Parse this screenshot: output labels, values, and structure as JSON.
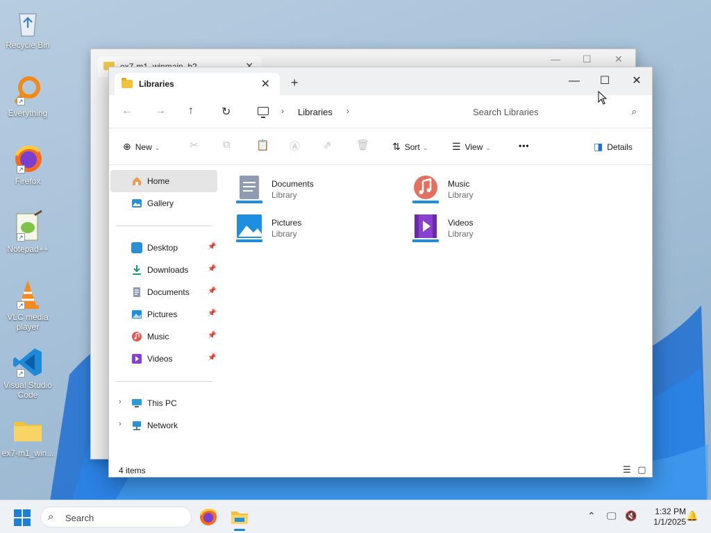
{
  "desktop": {
    "icons": [
      {
        "label": "Recycle Bin",
        "icon": "recycle-bin-icon"
      },
      {
        "label": "Everything",
        "icon": "search-magnifier-icon"
      },
      {
        "label": "Firefox",
        "icon": "firefox-icon"
      },
      {
        "label": "Notepad++",
        "icon": "notepad-plus-plus-icon"
      },
      {
        "label": "VLC media player",
        "icon": "vlc-cone-icon"
      },
      {
        "label": "Visual Studio Code",
        "icon": "vscode-icon"
      },
      {
        "label": "ex7-m1_win...",
        "icon": "folder-icon"
      }
    ]
  },
  "back_window": {
    "tab_title": "ex7-m1_winmain_b2"
  },
  "window": {
    "tab_title": "Libraries",
    "controls": {
      "minimize": "—",
      "maximize": "☐",
      "close": "✕",
      "new_tab": "+",
      "tab_close": "✕"
    },
    "nav": {
      "back": "←",
      "forward": "→",
      "up": "↑",
      "refresh": "↻"
    },
    "breadcrumb": {
      "separator": "›",
      "location": "Libraries"
    },
    "search": {
      "placeholder": "Search Libraries",
      "glyph": "⌕"
    },
    "command_bar": {
      "new_label": "New",
      "sort_label": "Sort",
      "view_label": "View",
      "more_glyph": "•••",
      "details_label": "Details",
      "caret": "⌄"
    },
    "sidebar": {
      "top": [
        {
          "label": "Home",
          "icon": "home-icon",
          "selected": true
        },
        {
          "label": "Gallery",
          "icon": "gallery-icon"
        }
      ],
      "pinned": [
        {
          "label": "Desktop",
          "icon": "desktop-folder-icon",
          "color": "#2b8fd6"
        },
        {
          "label": "Downloads",
          "icon": "download-arrow-icon",
          "color": "#1a9b6c"
        },
        {
          "label": "Documents",
          "icon": "documents-icon",
          "color": "#7a8aa0"
        },
        {
          "label": "Pictures",
          "icon": "pictures-icon",
          "color": "#1d8ee0"
        },
        {
          "label": "Music",
          "icon": "music-icon",
          "color": "#e05a4d"
        },
        {
          "label": "Videos",
          "icon": "videos-icon",
          "color": "#8a3fd1"
        }
      ],
      "bottom": [
        {
          "label": "This PC",
          "icon": "computer-icon"
        },
        {
          "label": "Network",
          "icon": "network-icon"
        }
      ],
      "pin_glyph": "📌",
      "chevron": "›"
    },
    "libraries": [
      {
        "name": "Documents",
        "type": "Library",
        "icon": "documents-library-icon"
      },
      {
        "name": "Music",
        "type": "Library",
        "icon": "music-library-icon"
      },
      {
        "name": "Pictures",
        "type": "Library",
        "icon": "pictures-library-icon"
      },
      {
        "name": "Videos",
        "type": "Library",
        "icon": "videos-library-icon"
      }
    ],
    "status": {
      "item_count": "4 items"
    }
  },
  "taskbar": {
    "search_label": "Search",
    "clock_time": "1:32 PM",
    "clock_date": "1/1/2025",
    "accent": "#1d7fd6"
  }
}
